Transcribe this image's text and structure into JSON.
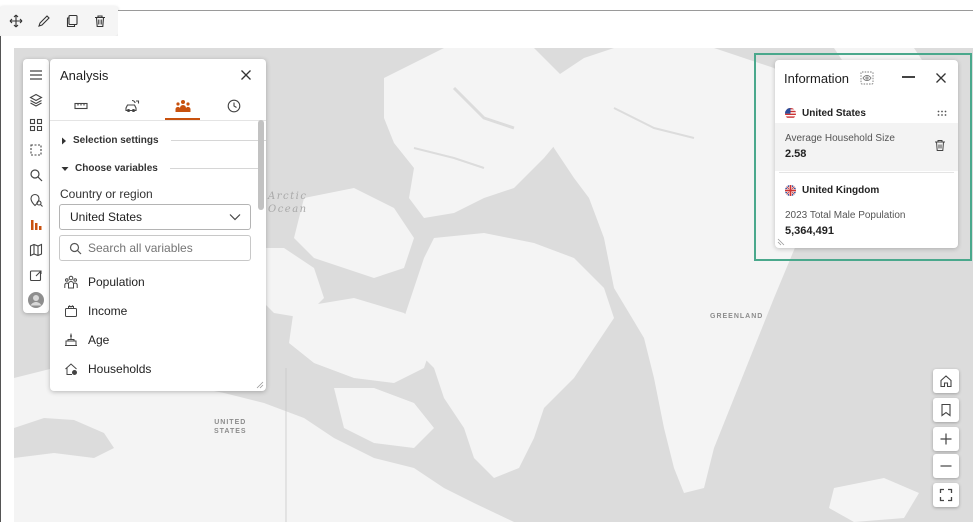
{
  "edit_toolbar": {
    "icons": [
      "move-icon",
      "pencil-icon",
      "duplicate-icon",
      "trash-icon"
    ]
  },
  "map": {
    "labels": {
      "arctic": "Arctic\nOcean",
      "greenland": "GREENLAND",
      "united_states": "UNITED\nSTATES"
    },
    "colors": {
      "land": "#f4f4f4",
      "water": "#dcdcdc"
    }
  },
  "left_rail": {
    "icons": [
      "menu-icon",
      "layers-icon",
      "qr-grid-icon",
      "select-rectangle-icon",
      "search-icon",
      "location-search-icon",
      "analysis-bars-icon",
      "map-icon",
      "share-icon",
      "avatar-icon"
    ],
    "active_color": "#c8510e"
  },
  "analysis": {
    "title": "Analysis",
    "tabs": [
      "ruler-icon",
      "car-route-icon",
      "demographics-icon",
      "clock-icon"
    ],
    "active_tab": 2,
    "sections": {
      "selection": "Selection settings",
      "choose": "Choose variables"
    },
    "country_label": "Country or region",
    "country_value": "United States",
    "search_placeholder": "Search all variables",
    "variables": [
      {
        "label": "Population",
        "icon": "population-icon"
      },
      {
        "label": "Income",
        "icon": "income-icon"
      },
      {
        "label": "Age",
        "icon": "age-icon"
      },
      {
        "label": "Households",
        "icon": "households-icon"
      }
    ]
  },
  "information": {
    "title": "Information",
    "cards": [
      {
        "country": "United States",
        "metric": "Average Household Size",
        "value": "2.58"
      },
      {
        "country": "United Kingdom",
        "metric": "2023 Total Male Population",
        "value": "5,364,491"
      }
    ],
    "highlight_color": "#4aa88c"
  },
  "map_controls": [
    "home-icon",
    "bookmark-icon",
    "zoom-in-icon",
    "zoom-out-icon",
    "fullscreen-icon"
  ]
}
